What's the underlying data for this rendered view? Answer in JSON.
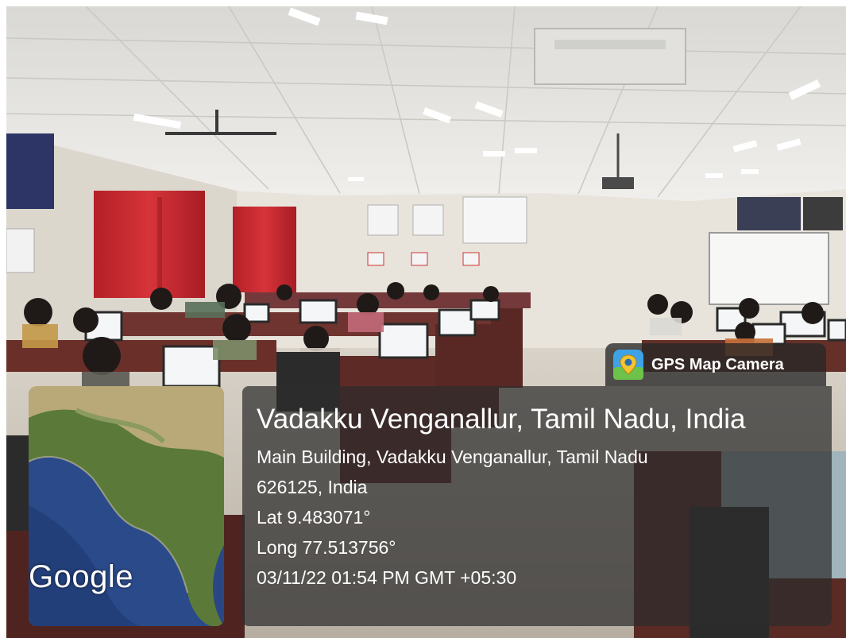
{
  "badge": {
    "app_name": "GPS Map Camera",
    "icon": "map-pin-icon"
  },
  "location": {
    "place": "Vadakku Venganallur, Tamil Nadu, India",
    "address_line1": "Main Building, Vadakku Venganallur, Tamil Nadu",
    "address_line2": "626125, India",
    "latitude": "Lat 9.483071°",
    "longitude": "Long 77.513756°",
    "datetime": "03/11/22 01:54 PM GMT +05:30"
  },
  "map": {
    "attribution": "Google"
  },
  "colors": {
    "wall": "#e9e6df",
    "ceiling": "#ecebe7",
    "curtain": "#c7272f",
    "desk": "#6b2f2a",
    "ocean": "#2b4a8a",
    "land": "#5b7a3a"
  }
}
